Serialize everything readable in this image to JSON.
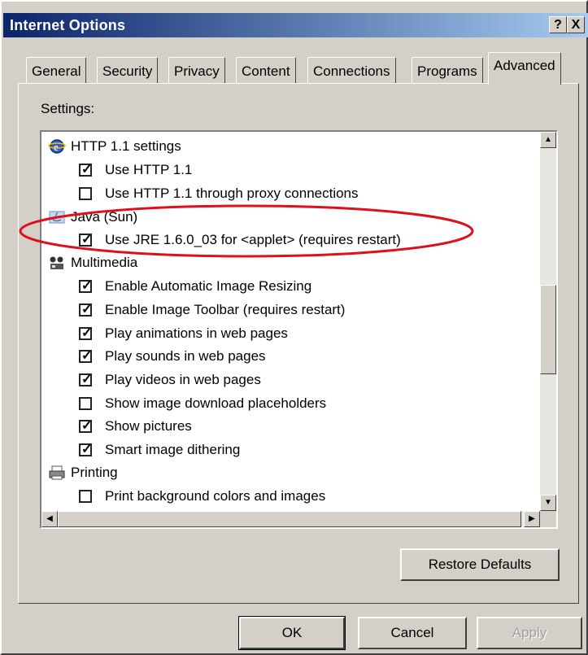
{
  "window": {
    "title": "Internet Options",
    "help_btn": "?",
    "close_btn": "X"
  },
  "tabs": [
    {
      "label": "General"
    },
    {
      "label": "Security"
    },
    {
      "label": "Privacy"
    },
    {
      "label": "Content"
    },
    {
      "label": "Connections"
    },
    {
      "label": "Programs"
    },
    {
      "label": "Advanced",
      "active": true
    }
  ],
  "settings_label": "Settings:",
  "list": {
    "http": {
      "label": "HTTP 1.1 settings",
      "icon": "ie-globe-icon",
      "items": [
        {
          "label": "Use HTTP 1.1",
          "checked": true
        },
        {
          "label": "Use HTTP 1.1 through proxy connections",
          "checked": false
        }
      ]
    },
    "java": {
      "label": "Java (Sun)",
      "icon": "java-icon",
      "items": [
        {
          "label": "Use JRE 1.6.0_03 for <applet> (requires restart)",
          "checked": true
        }
      ]
    },
    "multimedia": {
      "label": "Multimedia",
      "icon": "multimedia-icon",
      "items": [
        {
          "label": "Enable Automatic Image Resizing",
          "checked": true
        },
        {
          "label": "Enable Image Toolbar (requires restart)",
          "checked": true
        },
        {
          "label": "Play animations in web pages",
          "checked": true
        },
        {
          "label": "Play sounds in web pages",
          "checked": true
        },
        {
          "label": "Play videos in web pages",
          "checked": true
        },
        {
          "label": "Show image download placeholders",
          "checked": false
        },
        {
          "label": "Show pictures",
          "checked": true
        },
        {
          "label": "Smart image dithering",
          "checked": true
        }
      ]
    },
    "printing": {
      "label": "Printing",
      "icon": "printer-icon",
      "items": [
        {
          "label": "Print background colors and images",
          "checked": false
        }
      ]
    }
  },
  "buttons": {
    "restore": "Restore Defaults",
    "ok": "OK",
    "cancel": "Cancel",
    "apply": "Apply"
  },
  "colors": {
    "highlight": "#e0101a",
    "titlebar": "#0a246a"
  }
}
